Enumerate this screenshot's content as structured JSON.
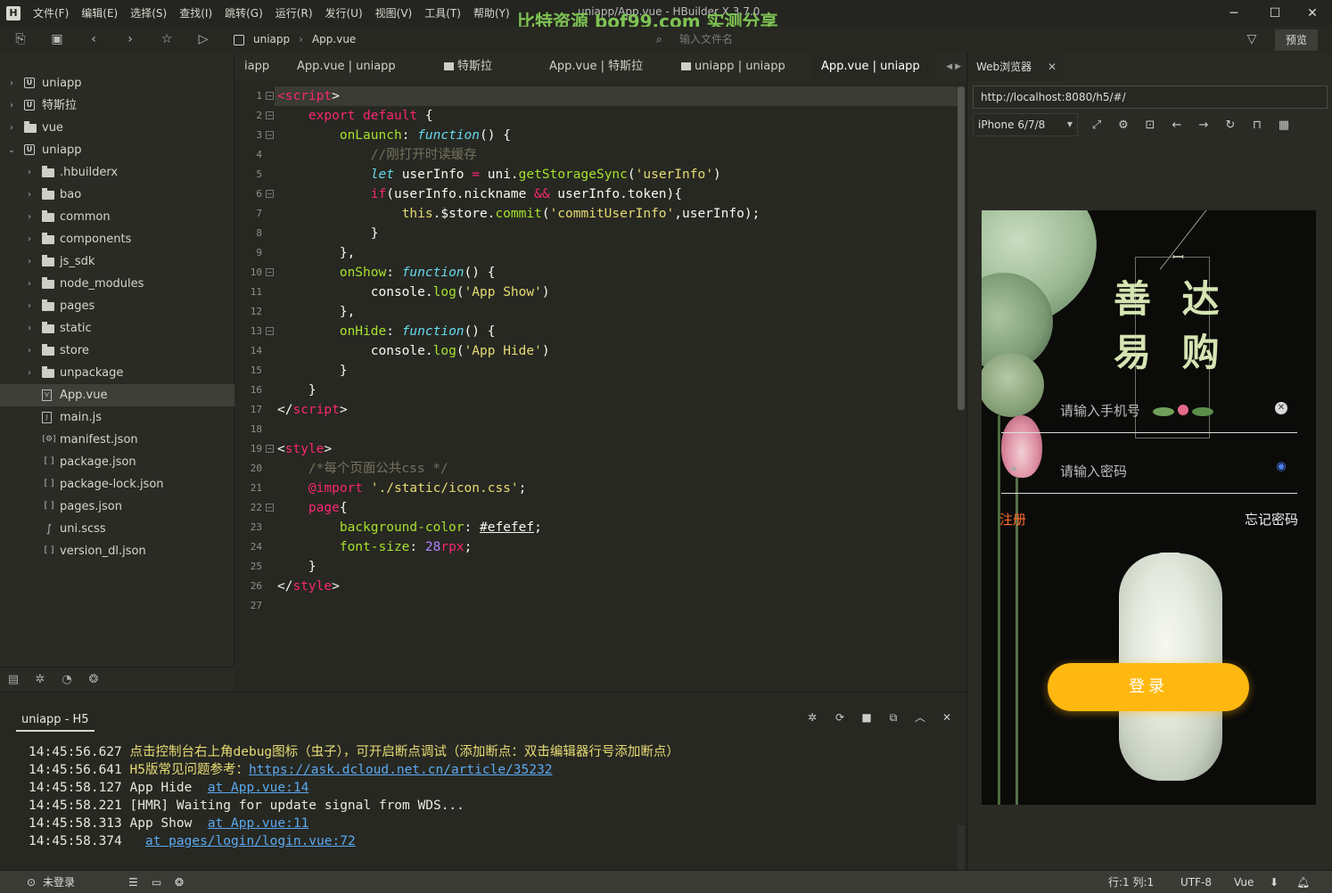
{
  "window": {
    "title": "uniapp/App.vue - HBuilder X 3.7.0",
    "watermark": "比特资源 bof99.com 实测分享",
    "menus": [
      "文件(F)",
      "编辑(E)",
      "选择(S)",
      "查找(I)",
      "跳转(G)",
      "运行(R)",
      "发行(U)",
      "视图(V)",
      "工具(T)",
      "帮助(Y)"
    ],
    "logo": "H"
  },
  "toolbar": {
    "breadcrumb": [
      "uniapp",
      "App.vue"
    ],
    "breadcrumb_separator": "›",
    "file_search_placeholder": "输入文件名",
    "preview_label": "预览"
  },
  "sidebar": {
    "items": [
      {
        "label": "uniapp",
        "type": "project",
        "expanded": false
      },
      {
        "label": "特斯拉",
        "type": "project",
        "expanded": false
      },
      {
        "label": "vue",
        "type": "folder-root",
        "expanded": false
      },
      {
        "label": "uniapp",
        "type": "project",
        "expanded": true
      },
      {
        "label": ".hbuilderx",
        "type": "folder"
      },
      {
        "label": "bao",
        "type": "folder"
      },
      {
        "label": "common",
        "type": "folder"
      },
      {
        "label": "components",
        "type": "folder"
      },
      {
        "label": "js_sdk",
        "type": "folder"
      },
      {
        "label": "node_modules",
        "type": "folder"
      },
      {
        "label": "pages",
        "type": "folder"
      },
      {
        "label": "static",
        "type": "folder"
      },
      {
        "label": "store",
        "type": "folder"
      },
      {
        "label": "unpackage",
        "type": "folder"
      },
      {
        "label": "App.vue",
        "type": "file-vue",
        "selected": true
      },
      {
        "label": "main.js",
        "type": "file-js"
      },
      {
        "label": "manifest.json",
        "type": "file-manifest"
      },
      {
        "label": "package.json",
        "type": "file-json"
      },
      {
        "label": "package-lock.json",
        "type": "file-json"
      },
      {
        "label": "pages.json",
        "type": "file-json"
      },
      {
        "label": "uni.scss",
        "type": "file-scss"
      },
      {
        "label": "version_dl.json",
        "type": "file-json"
      }
    ]
  },
  "tabs": [
    {
      "label": "iapp",
      "folder": false,
      "active": false
    },
    {
      "label": "App.vue | uniapp",
      "folder": false,
      "active": false
    },
    {
      "label": "特斯拉",
      "folder": true,
      "active": false
    },
    {
      "label": "App.vue | 特斯拉",
      "folder": false,
      "active": false
    },
    {
      "label": "uniapp | uniapp",
      "folder": true,
      "active": false
    },
    {
      "label": "App.vue | uniapp",
      "folder": false,
      "active": true
    }
  ],
  "editor": {
    "cursor": {
      "line": 1,
      "col": 1
    },
    "lines": [
      [
        [
          "t",
          "<"
        ],
        [
          "k",
          "script"
        ],
        [
          "w",
          ">"
        ]
      ],
      [
        [
          "w",
          "    "
        ],
        [
          "k",
          "export"
        ],
        [
          "w",
          " "
        ],
        [
          "k",
          "default"
        ],
        [
          "w",
          " {"
        ]
      ],
      [
        [
          "w",
          "        "
        ],
        [
          "f",
          "onLaunch"
        ],
        [
          "w",
          ": "
        ],
        [
          "i",
          "function"
        ],
        [
          "w",
          "() {"
        ]
      ],
      [
        [
          "w",
          "            "
        ],
        [
          "c",
          "//刚打开时读缓存"
        ]
      ],
      [
        [
          "w",
          "            "
        ],
        [
          "i",
          "let"
        ],
        [
          "w",
          " userInfo "
        ],
        [
          "k",
          "="
        ],
        [
          "w",
          " uni."
        ],
        [
          "f",
          "getStorageSync"
        ],
        [
          "w",
          "("
        ],
        [
          "s",
          "'userInfo'"
        ],
        [
          "w",
          ")"
        ]
      ],
      [
        [
          "w",
          "            "
        ],
        [
          "k",
          "if"
        ],
        [
          "w",
          "(userInfo.nickname "
        ],
        [
          "k",
          "&&"
        ],
        [
          "w",
          " userInfo.token){"
        ]
      ],
      [
        [
          "w",
          "                "
        ],
        [
          "s",
          "this"
        ],
        [
          "w",
          ".$store."
        ],
        [
          "f",
          "commit"
        ],
        [
          "w",
          "("
        ],
        [
          "s",
          "'commitUserInfo'"
        ],
        [
          "w",
          ",userInfo);"
        ]
      ],
      [
        [
          "w",
          "            }"
        ]
      ],
      [
        [
          "w",
          "        },"
        ]
      ],
      [
        [
          "w",
          "        "
        ],
        [
          "f",
          "onShow"
        ],
        [
          "w",
          ": "
        ],
        [
          "i",
          "function"
        ],
        [
          "w",
          "() {"
        ]
      ],
      [
        [
          "w",
          "            console."
        ],
        [
          "f",
          "log"
        ],
        [
          "w",
          "("
        ],
        [
          "s",
          "'App Show'"
        ],
        [
          "w",
          ")"
        ]
      ],
      [
        [
          "w",
          "        },"
        ]
      ],
      [
        [
          "w",
          "        "
        ],
        [
          "f",
          "onHide"
        ],
        [
          "w",
          ": "
        ],
        [
          "i",
          "function"
        ],
        [
          "w",
          "() {"
        ]
      ],
      [
        [
          "w",
          "            console."
        ],
        [
          "f",
          "log"
        ],
        [
          "w",
          "("
        ],
        [
          "s",
          "'App Hide'"
        ],
        [
          "w",
          ")"
        ]
      ],
      [
        [
          "w",
          "        }"
        ]
      ],
      [
        [
          "w",
          "    }"
        ]
      ],
      [
        [
          "w",
          "</"
        ],
        [
          "k",
          "script"
        ],
        [
          "w",
          ">"
        ]
      ],
      [],
      [
        [
          "w",
          "<"
        ],
        [
          "k",
          "style"
        ],
        [
          "w",
          ">"
        ]
      ],
      [
        [
          "w",
          "    "
        ],
        [
          "c",
          "/*每个页面公共css */"
        ]
      ],
      [
        [
          "w",
          "    "
        ],
        [
          "k",
          "@import"
        ],
        [
          "w",
          " "
        ],
        [
          "s",
          "'./static/icon.css'"
        ],
        [
          "w",
          ";"
        ]
      ],
      [
        [
          "w",
          "    "
        ],
        [
          "k",
          "page"
        ],
        [
          "w",
          "{"
        ]
      ],
      [
        [
          "w",
          "        "
        ],
        [
          "f",
          "background-color"
        ],
        [
          "w",
          ": "
        ],
        [
          "ul",
          "#efefef"
        ],
        [
          "w",
          ";"
        ]
      ],
      [
        [
          "w",
          "        "
        ],
        [
          "f",
          "font-size"
        ],
        [
          "w",
          ": "
        ],
        [
          "n",
          "28"
        ],
        [
          "k",
          "rpx"
        ],
        [
          "w",
          ";"
        ]
      ],
      [
        [
          "w",
          "    }"
        ]
      ],
      [
        [
          "w",
          "</"
        ],
        [
          "k",
          "style"
        ],
        [
          "w",
          ">"
        ]
      ],
      []
    ],
    "fold_lines": [
      1,
      2,
      3,
      6,
      10,
      13,
      19,
      22
    ]
  },
  "console": {
    "tab": "uniapp - H5",
    "lines": [
      {
        "time": "14:45:56.627",
        "msg": "点击控制台右上角debug图标（虫子），可开启断点调试（添加断点：双击编辑器行号添加断点）",
        "style": "yellow",
        "link": ""
      },
      {
        "time": "14:45:56.641",
        "msg": "H5版常见问题参考：",
        "style": "yellow",
        "link": "https://ask.dcloud.net.cn/article/35232"
      },
      {
        "time": "14:45:58.127",
        "msg": "App Hide  ",
        "style": "normal",
        "link": "at App.vue:14"
      },
      {
        "time": "14:45:58.221",
        "msg": "[HMR] Waiting for update signal from WDS...",
        "style": "normal",
        "link": ""
      },
      {
        "time": "14:45:58.313",
        "msg": "App Show  ",
        "style": "normal",
        "link": "at App.vue:11"
      },
      {
        "time": "14:45:58.374",
        "msg": "  ",
        "style": "normal",
        "link": "at pages/login/login.vue:72"
      }
    ]
  },
  "browser": {
    "tab_label": "Web浏览器",
    "url": "http://localhost:8080/h5/#/",
    "device": "iPhone 6/7/8",
    "app": {
      "logo_text": "善 达 易 购",
      "phone_placeholder": "请输入手机号",
      "password_placeholder": "请输入密码",
      "register_label": "注册",
      "forgot_label": "忘记密码",
      "login_label": "登录"
    }
  },
  "statusbar": {
    "login_status": "未登录",
    "position": "行:1   列:1",
    "encoding": "UTF-8",
    "language": "Vue"
  },
  "colors": {
    "editor_bg": "#272822",
    "keyword": "#f92672",
    "function": "#a6e22e",
    "string": "#e6db74",
    "italic_keyword": "#66d9ef",
    "comment": "#75715e",
    "login_button": "#ffb80f",
    "register_text": "#ff6e2e",
    "console_link": "#5ba9ef"
  }
}
